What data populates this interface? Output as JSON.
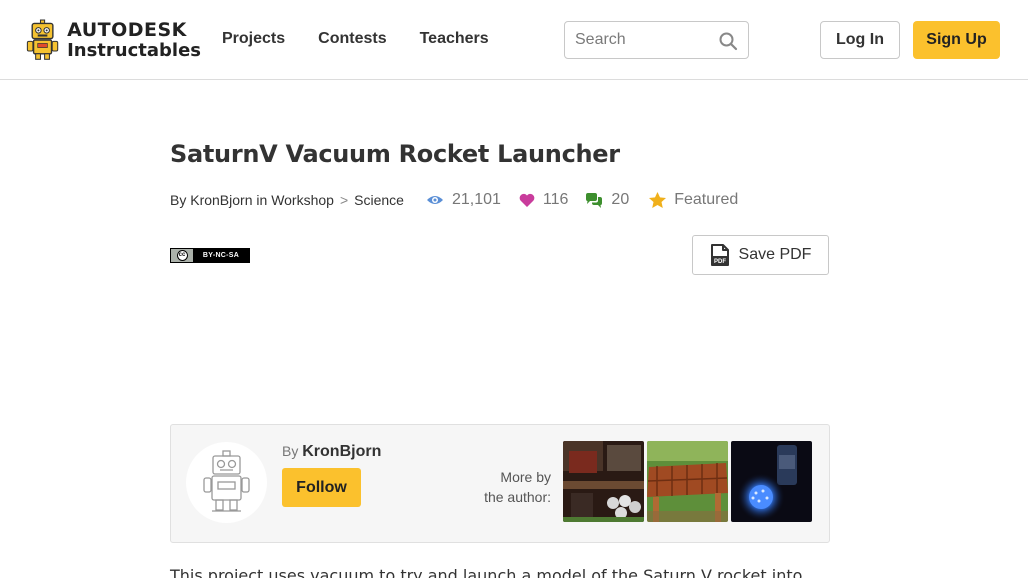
{
  "header": {
    "logo_brand": "AUTODESK",
    "logo_product": "Instructables",
    "nav": [
      "Projects",
      "Contests",
      "Teachers"
    ],
    "search_placeholder": "Search",
    "login_label": "Log In",
    "signup_label": "Sign Up"
  },
  "article": {
    "title": "SaturnV Vacuum Rocket Launcher",
    "by_label": "By",
    "author": "KronBjorn",
    "in_label": "in",
    "category": "Workshop",
    "separator": ">",
    "subcategory": "Science",
    "views": "21,101",
    "favorites": "116",
    "comments": "20",
    "featured_label": "Featured",
    "license_terms": "BY-NC-SA",
    "save_pdf_label": "Save PDF",
    "intro_text": "This project uses vacuum to try and launch a model of the Saturn V rocket into"
  },
  "author_card": {
    "by_label": "By",
    "name": "KronBjorn",
    "follow_label": "Follow",
    "more_line1": "More by",
    "more_line2": "the author:"
  },
  "colors": {
    "accent_yellow": "#fbc12d",
    "view_icon": "#5b8fd6",
    "heart_icon": "#c93c9c",
    "comment_icon": "#3d8f2e",
    "star_icon": "#f0b01b"
  },
  "icons": {
    "search": "magnifier-icon",
    "views": "eye-icon",
    "favorites": "heart-icon",
    "comments": "chat-bubbles-icon",
    "featured": "star-icon",
    "pdf": "pdf-file-icon"
  }
}
